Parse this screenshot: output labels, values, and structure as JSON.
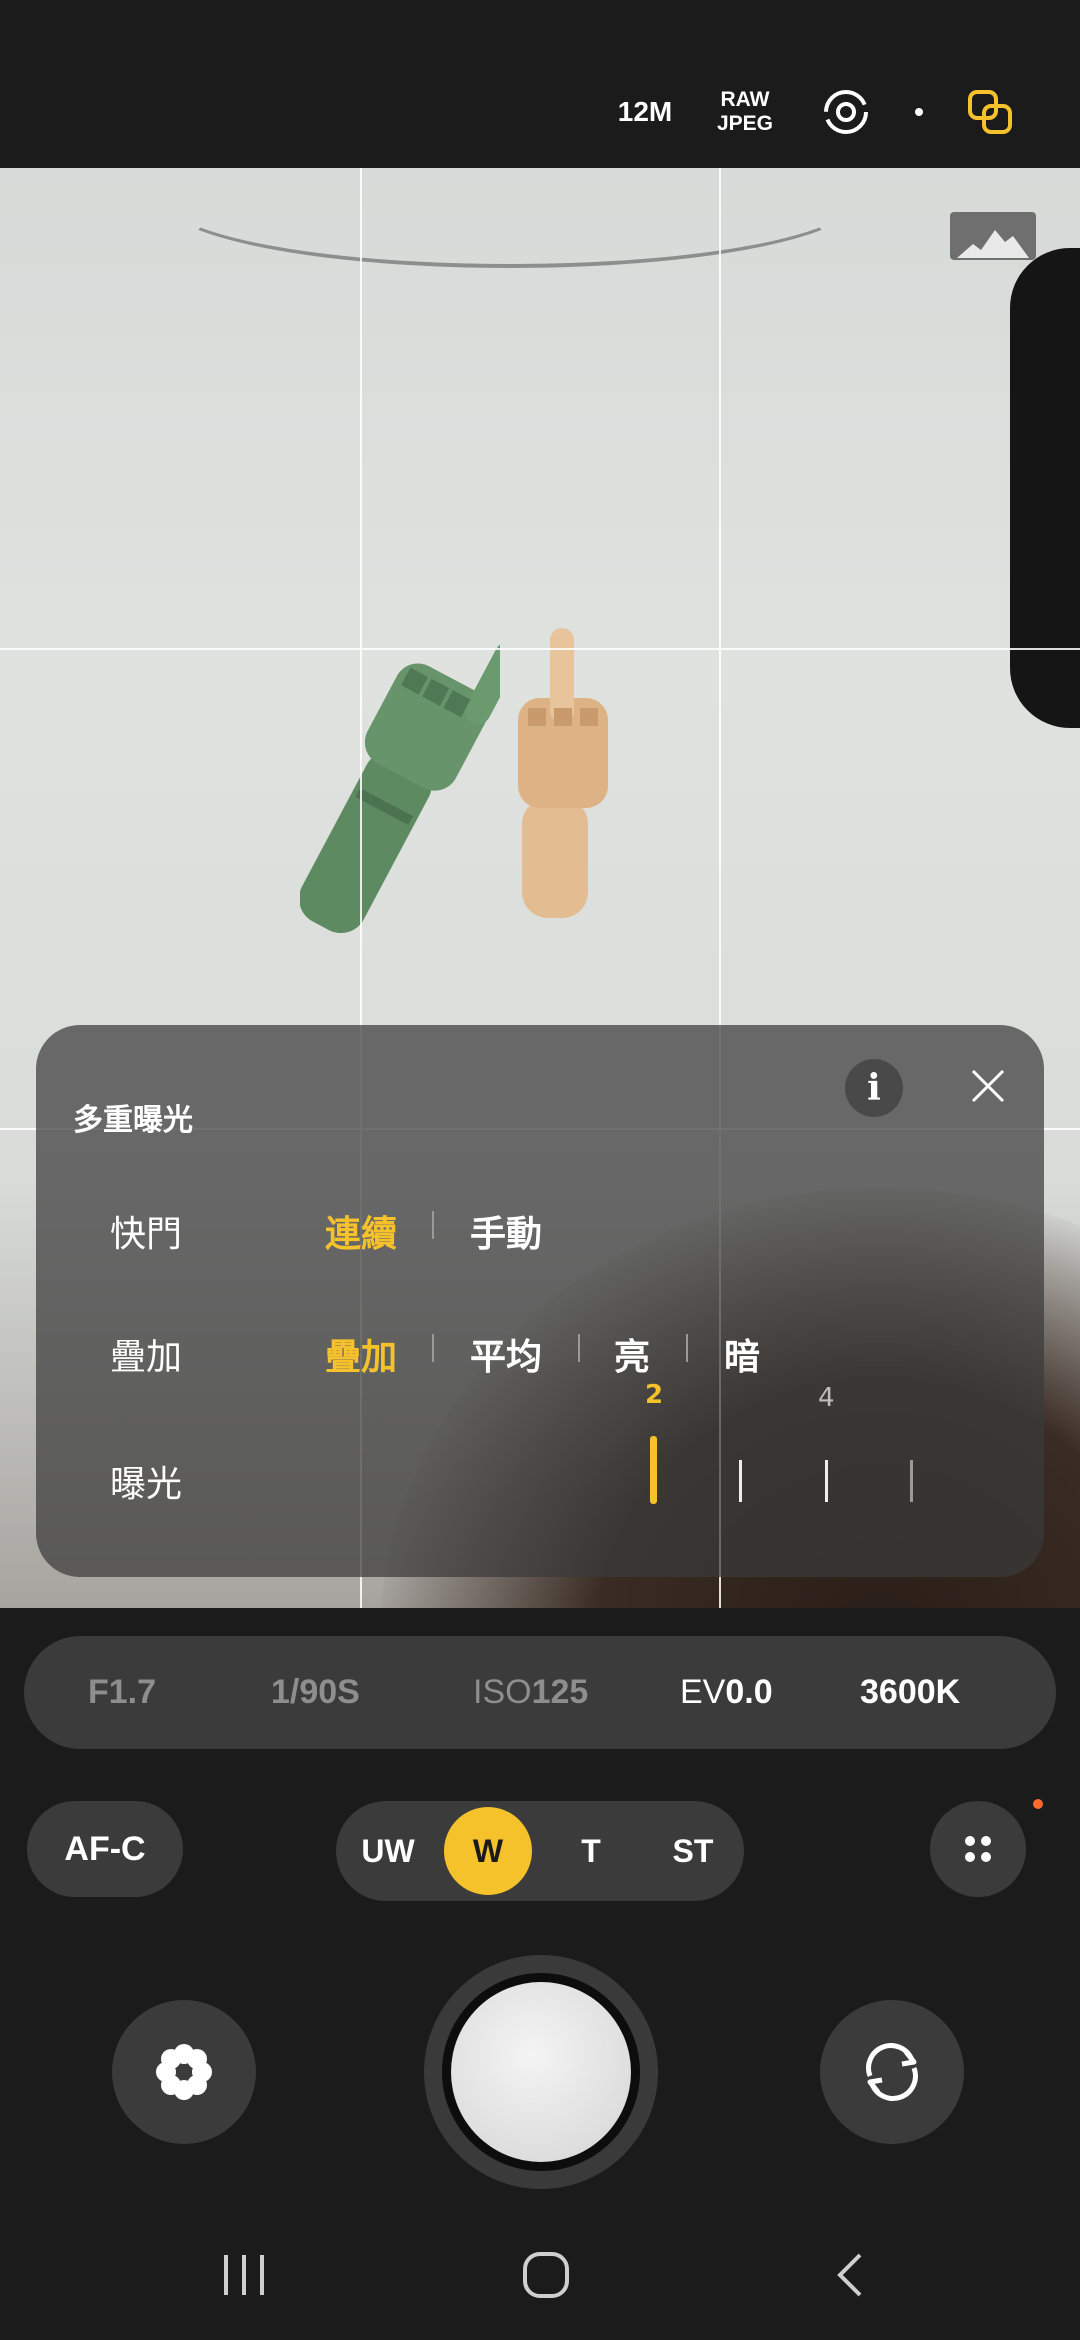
{
  "top_bar": {
    "resolution": "12M",
    "format_line1": "RAW",
    "format_line2": "JPEG",
    "icons": [
      "stabilization-icon",
      "dot-indicator-icon",
      "multi-exposure-icon"
    ]
  },
  "panel": {
    "title": "多重曝光",
    "shutter_label": "快門",
    "shutter_options": [
      "連續",
      "手動"
    ],
    "shutter_selected": 0,
    "overlay_label": "疊加",
    "overlay_options": [
      "疊加",
      "平均",
      "亮",
      "暗"
    ],
    "overlay_selected": 0,
    "exposure_label": "曝光",
    "exposure_selected_value": "2",
    "exposure_marker_value": "4",
    "exposure_tick_count": 4
  },
  "pro": {
    "aperture": "F1.7",
    "shutter_speed": "1/90S",
    "iso_label": "ISO",
    "iso_value": "125",
    "ev_label": "EV",
    "ev_value": "0.0",
    "white_balance": "3600K"
  },
  "af_mode": "AF-C",
  "lenses": [
    "UW",
    "W",
    "T",
    "ST"
  ],
  "lens_selected": "W",
  "colors": {
    "accent": "#f5c22c",
    "panel_bg": "#3a3a3a",
    "notification": "#ff6a2b"
  }
}
